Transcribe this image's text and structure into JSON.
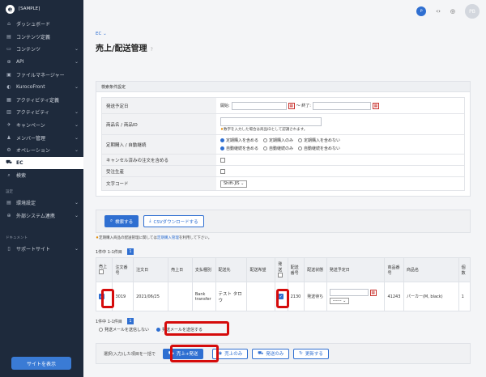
{
  "brand": {
    "name": "[SAMPLE]",
    "logo": "e"
  },
  "nav": {
    "items": [
      {
        "label": "ダッシュボード",
        "icon": "dashboard-icon",
        "glyph": "⌂"
      },
      {
        "label": "コンテンツ定義",
        "icon": "content-def-icon",
        "glyph": "▤"
      },
      {
        "label": "コンテンツ",
        "icon": "content-icon",
        "glyph": "▭",
        "chevron": "⌄"
      },
      {
        "label": "API",
        "icon": "api-icon",
        "glyph": "⊕",
        "chevron": "⌄"
      },
      {
        "label": "ファイルマネージャー",
        "icon": "file-icon",
        "glyph": "▣"
      },
      {
        "label": "KurocoFront",
        "icon": "front-icon",
        "glyph": "◐",
        "chevron": "⌄"
      },
      {
        "label": "アクティビティ定義",
        "icon": "activity-def-icon",
        "glyph": "▦"
      },
      {
        "label": "アクティビティ",
        "icon": "activity-icon",
        "glyph": "▥",
        "chevron": "⌄"
      },
      {
        "label": "キャンペーン",
        "icon": "campaign-icon",
        "glyph": "✈",
        "chevron": "⌄"
      },
      {
        "label": "メンバー管理",
        "icon": "member-icon",
        "glyph": "♟",
        "chevron": "⌄"
      },
      {
        "label": "オペレーション",
        "icon": "operation-icon",
        "glyph": "⚙",
        "chevron": "⌄"
      },
      {
        "label": "EC",
        "icon": "cart-icon",
        "glyph": "⛟",
        "active": true
      },
      {
        "label": "検索",
        "icon": "search-icon",
        "glyph": "⌕"
      }
    ],
    "settings_label": "設定",
    "settings_items": [
      {
        "label": "環境設定",
        "icon": "env-settings-icon",
        "glyph": "▤",
        "chevron": "⌄"
      },
      {
        "label": "外部システム連携",
        "icon": "integration-icon",
        "glyph": "⊕",
        "chevron": "⌄"
      }
    ],
    "docs_label": "ドキュメント",
    "docs_items": [
      {
        "label": "サポートサイト",
        "icon": "book-icon",
        "glyph": "▯",
        "chevron": "⌄"
      }
    ],
    "view_site_button": "サイトを表示"
  },
  "topbar": {
    "avatar_initials": "P",
    "user_initials": "PB"
  },
  "breadcrumb": "EC ⌄",
  "page_title": "売上/配送管理",
  "search": {
    "section_title": "検索条件設定",
    "rows": {
      "ship_date_label": "発送予定日",
      "ship_date_start": "開始:",
      "ship_date_end": "～ 終了:",
      "product_label": "商品名 / 商品ID",
      "product_note": "数字を入力した場合は商品IDとして認識されます。",
      "subscription_label": "定期購入 / 自動継続",
      "sub_options": [
        "定期購入を含める",
        "定期購入のみ",
        "定期購入を含めない"
      ],
      "renew_options": [
        "自動継続を含める",
        "自動継続のみ",
        "自動継続を含めない"
      ],
      "cancel_label": "キャンセル済みの注文を含める",
      "backorder_label": "受注生産",
      "charset_label": "文字コード",
      "charset_value": "Shift-JIS ⌄"
    },
    "search_button": "検索する",
    "csv_button": "CSVダウンロードする"
  },
  "notice": {
    "text": "定期購入商品の配送管理に関しては",
    "link": "定期購入管理",
    "suffix": "を利用して下さい。"
  },
  "result_info": "1件中 1-1件目",
  "page_number": "1",
  "table": {
    "headers": {
      "sales": "売上",
      "order_no": "注文番号",
      "order_date": "注文日",
      "sales_date": "売上日",
      "payment": "支払種別",
      "ship_to": "配送先",
      "ship_hope": "配送希望",
      "shipped": "発送",
      "ship_no": "配送番号",
      "ship_status": "配送状態",
      "ship_date": "発送予定日",
      "product_no": "商品番号",
      "product_name": "商品名",
      "qty": "個数"
    },
    "rows": [
      {
        "order_no": "3019",
        "order_date": "2021/06/25",
        "sales_date": "",
        "payment": "Bank transfer",
        "ship_to": "テスト タロウ",
        "ship_no": "2130",
        "ship_status": "発送待ち",
        "time_placeholder": "------ ⌄",
        "product_no": "41243",
        "product_name": "パーカー(M, black)",
        "qty": "1"
      }
    ]
  },
  "mail": {
    "no_send": "発送メールを送信しない",
    "send": "発送メールを送信する"
  },
  "bulk": {
    "label": "選択(入力)した項目を一括で",
    "btn_both": "売上+発送",
    "btn_sales": "売上のみ",
    "btn_ship": "発送のみ",
    "btn_update": "更新する"
  }
}
